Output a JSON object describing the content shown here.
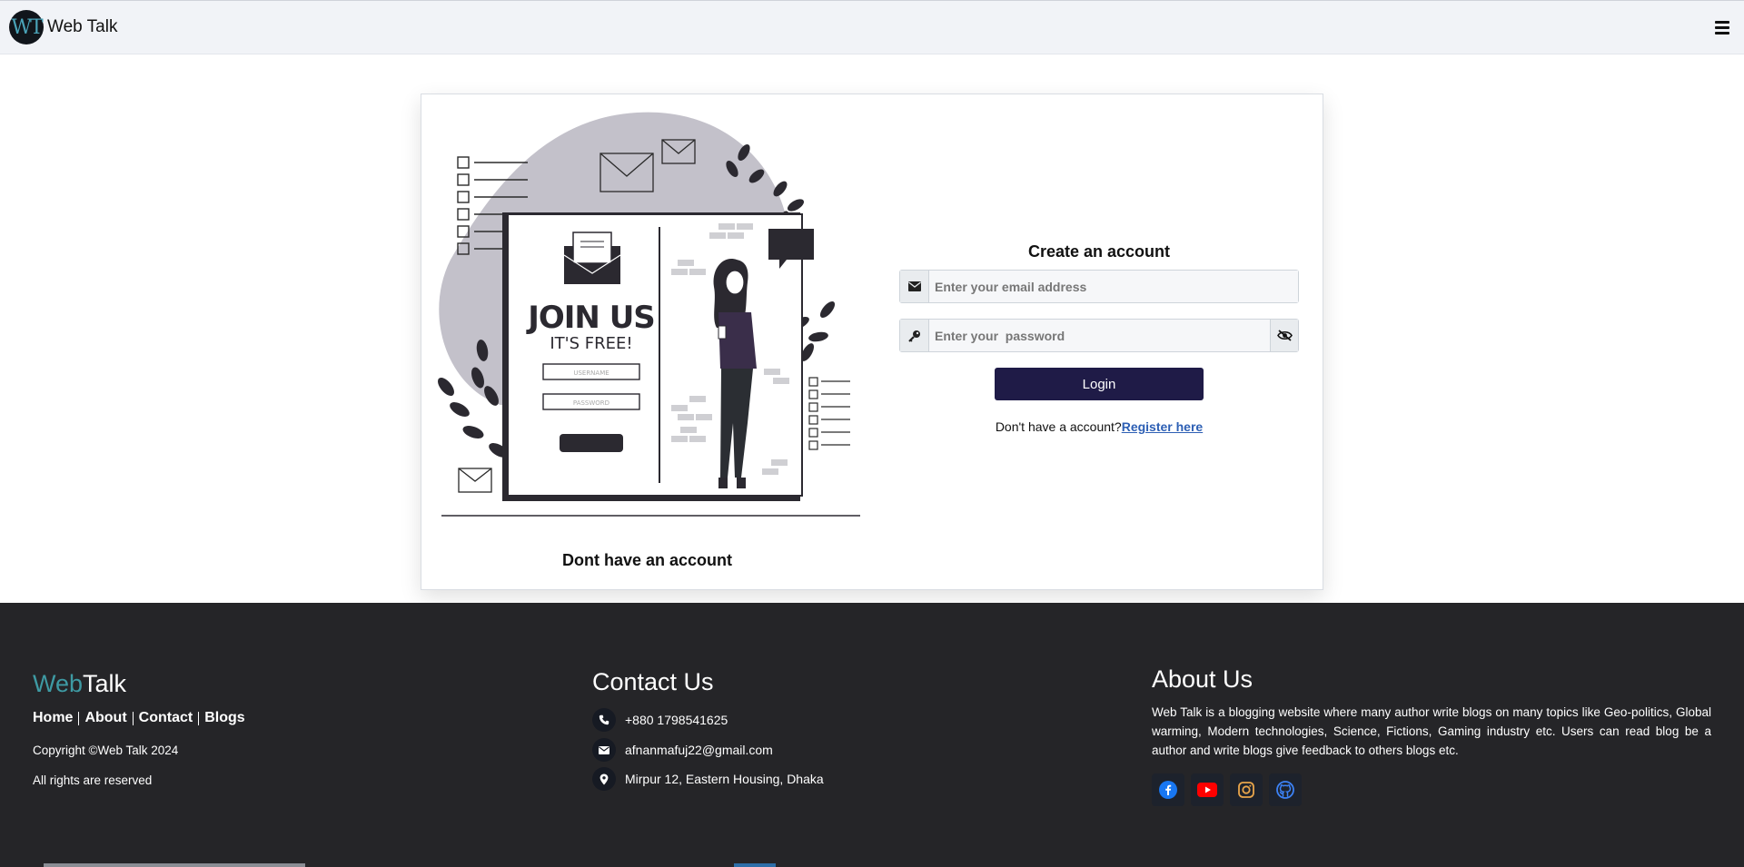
{
  "navbar": {
    "logo_text": "WT",
    "brand": "Web Talk",
    "menu_icon": "hamburger-menu-icon"
  },
  "illustration": {
    "headline": "JOIN US",
    "subhead": "IT'S FREE!",
    "username_hint": "USERNAME",
    "password_hint": "PASSWORD"
  },
  "left_caption": "Dont have an account",
  "form": {
    "title": "Create an account",
    "email_placeholder": "Enter your email address",
    "password_placeholder": "Enter your  password",
    "login_label": "Login",
    "no_account_text": "Don't have a account?",
    "register_label": "Register here",
    "icons": {
      "email": "envelope-icon",
      "password": "key-icon",
      "toggle": "eye-slash-icon"
    }
  },
  "footer": {
    "brand_web": "Web",
    "brand_talk": "Talk",
    "nav": [
      "Home",
      "About",
      "Contact",
      "Blogs"
    ],
    "copyright": "Copyright ©Web Talk 2024",
    "rights": "All rights are reserved",
    "contact_title": "Contact Us",
    "phone": "+880 1798541625",
    "email": "afnanmafuj22@gmail.com",
    "address": "Mirpur 12, Eastern Housing, Dhaka",
    "about_title": "About Us",
    "about_text": "Web Talk is a blogging website where many author write blogs on many topics like Geo-politics, Global warming, Modern technologies, Science, Fictions, Gaming industry etc. Users can read blog be a author and write blogs give feedback to others blogs etc.",
    "socials": [
      "facebook-icon",
      "youtube-icon",
      "instagram-icon",
      "github-icon"
    ],
    "colors": {
      "background": "#252528",
      "brand_accent": "#3e9aa3",
      "button": "#1f1b47",
      "link": "#2d5fb4"
    }
  }
}
